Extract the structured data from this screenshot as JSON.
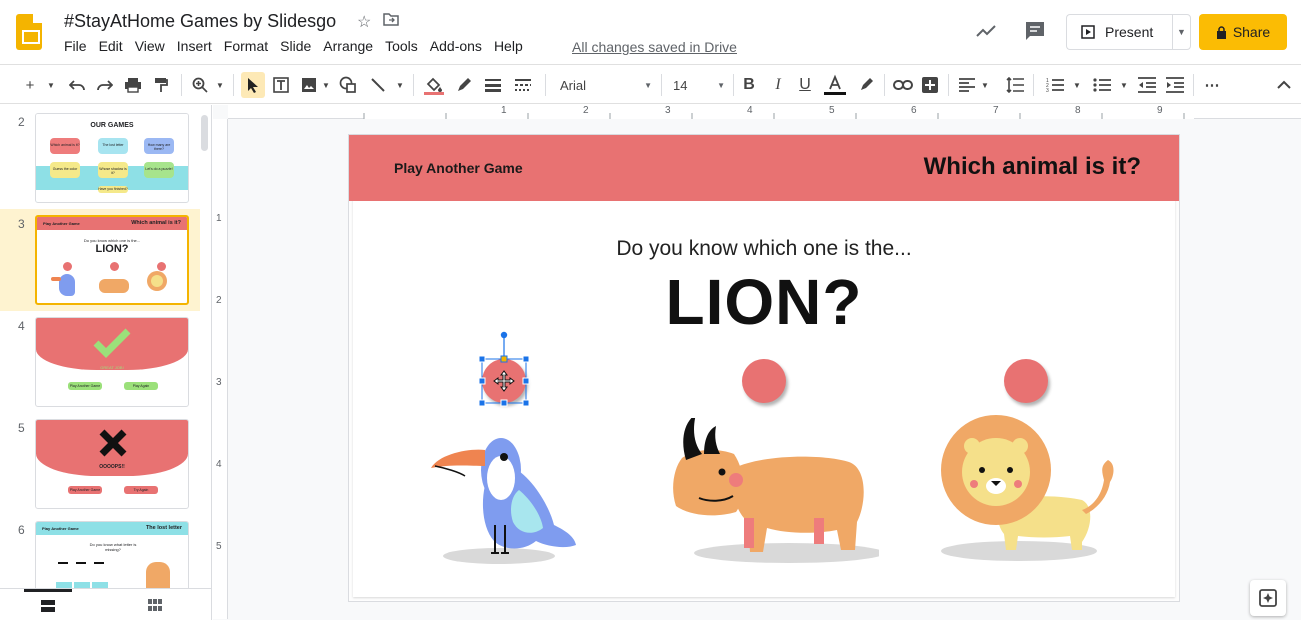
{
  "header": {
    "doc_title": "#StayAtHome Games by Slidesgo",
    "menu": [
      "File",
      "Edit",
      "View",
      "Insert",
      "Format",
      "Slide",
      "Arrange",
      "Tools",
      "Add-ons",
      "Help"
    ],
    "saved_status": "All changes saved in Drive",
    "present_label": "Present",
    "share_label": "Share"
  },
  "toolbar": {
    "font": "Arial",
    "font_size": "14"
  },
  "ruler": {
    "top_ticks": [
      "1",
      "2",
      "3",
      "4",
      "5",
      "6",
      "7",
      "8",
      "9"
    ],
    "left_ticks": [
      "1",
      "2",
      "3",
      "4",
      "5"
    ]
  },
  "filmstrip": {
    "slides": [
      {
        "num": "2",
        "title": "OUR GAMES",
        "buttons": [
          "Which animal is it?",
          "The lost letter",
          "How many are there?",
          "Guess the color",
          "Whose shadow is it?",
          "Let's do a puzzle!"
        ],
        "footer": "Have you finished?"
      },
      {
        "num": "3",
        "left": "Play Another Game",
        "right": "Which animal is it?",
        "question": "Do you know which one is the...",
        "word": "LION?"
      },
      {
        "num": "4",
        "caption": "GREAT JOB!",
        "btn1": "Play Another Game",
        "btn2": "Play Again"
      },
      {
        "num": "5",
        "caption": "OOOOPS!!",
        "btn1": "Play Another Game",
        "btn2": "Try Again"
      },
      {
        "num": "6",
        "left": "Play Another Game",
        "right": "The lost letter",
        "question": "Do you know what letter is missing?"
      }
    ]
  },
  "slide": {
    "header_left": "Play Another Game",
    "header_right": "Which animal is it?",
    "question": "Do you know which one is the...",
    "answer": "LION?"
  },
  "colors": {
    "accent": "#e87272",
    "share": "#fbbc04",
    "selected_thumb": "#f4b400",
    "selection_handles": "#1a73e8"
  }
}
